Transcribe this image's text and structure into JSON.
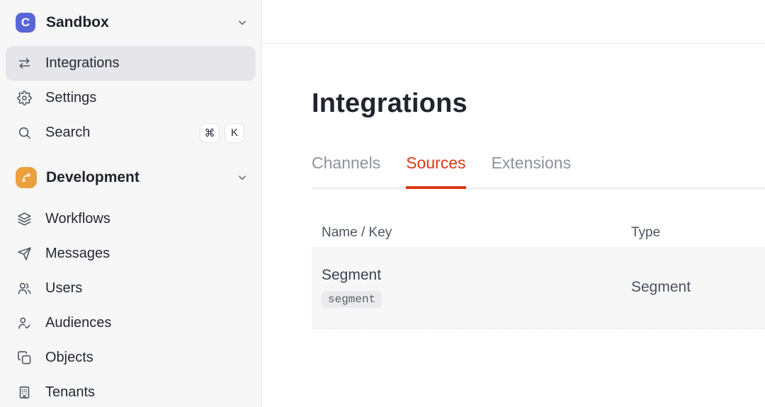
{
  "workspace": {
    "name": "Sandbox",
    "logo_letter": "C"
  },
  "sidebar": {
    "items": [
      {
        "label": "Integrations",
        "icon": "transfer-arrows-icon",
        "active": true
      },
      {
        "label": "Settings",
        "icon": "gear-icon",
        "active": false
      },
      {
        "label": "Search",
        "icon": "search-icon",
        "active": false
      }
    ],
    "search_shortcut": {
      "key1": "⌘",
      "key2": "K"
    },
    "section": {
      "label": "Development",
      "icon": "git-branch-icon"
    },
    "section_items": [
      {
        "label": "Workflows",
        "icon": "layers-icon"
      },
      {
        "label": "Messages",
        "icon": "paper-plane-icon"
      },
      {
        "label": "Users",
        "icon": "users-icon"
      },
      {
        "label": "Audiences",
        "icon": "person-check-icon"
      },
      {
        "label": "Objects",
        "icon": "copy-icon"
      },
      {
        "label": "Tenants",
        "icon": "building-icon"
      }
    ]
  },
  "main": {
    "title": "Integrations",
    "tabs": [
      {
        "label": "Channels",
        "active": false
      },
      {
        "label": "Sources",
        "active": true
      },
      {
        "label": "Extensions",
        "active": false
      }
    ],
    "table": {
      "columns": [
        "Name / Key",
        "Type"
      ],
      "rows": [
        {
          "name": "Segment",
          "key": "segment",
          "type": "Segment"
        }
      ]
    }
  },
  "colors": {
    "accent": "#d93a15",
    "logo_blue": "#5765d9",
    "development_orange": "#eba03d"
  }
}
